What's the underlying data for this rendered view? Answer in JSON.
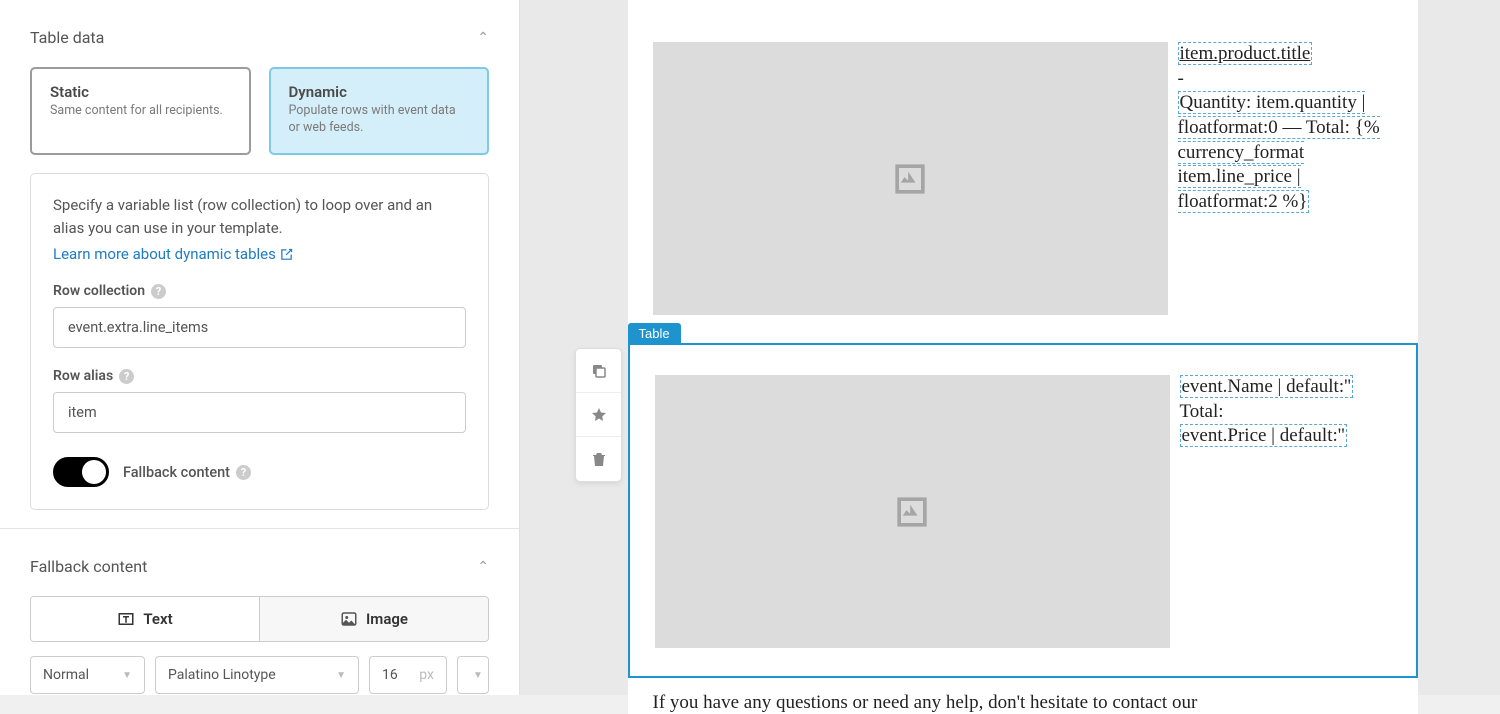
{
  "sidebar": {
    "tableData": {
      "title": "Table data",
      "static": {
        "title": "Static",
        "desc": "Same content for all recipients."
      },
      "dynamic": {
        "title": "Dynamic",
        "desc": "Populate rows with event data or web feeds."
      },
      "instruction": "Specify a variable list (row collection) to loop over and an alias you can use in your template.",
      "learnLink": "Learn more about dynamic tables",
      "rowCollection": {
        "label": "Row collection",
        "value": "event.extra.line_items"
      },
      "rowAlias": {
        "label": "Row alias",
        "value": "item"
      },
      "fallbackToggleLabel": "Fallback content"
    },
    "fallback": {
      "title": "Fallback content",
      "textBtn": "Text",
      "imageBtn": "Image"
    },
    "bottomBar": {
      "style": "Normal",
      "font": "Palatino Linotype",
      "size": "16",
      "unit": "px"
    }
  },
  "canvas": {
    "blockLabel": "Table",
    "row1": {
      "title": "item.product.title",
      "sep": "-",
      "qtyLabel": "Quantity:",
      "qtyExpr": "item.quantity | floatformat:0",
      "totalSep": " — Total: ",
      "totalExpr": "{% currency_format item.line_price | floatformat:2 %}"
    },
    "row2": {
      "nameExpr": "event.Name | default:''",
      "totalLabel": "Total:",
      "priceExpr": "event.Price | default:''"
    },
    "footer": "If you have any questions or need any help, don't hesitate to contact our"
  }
}
